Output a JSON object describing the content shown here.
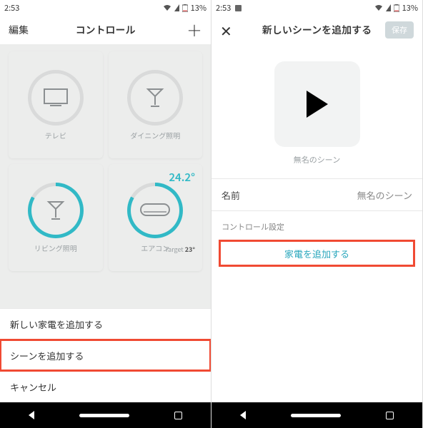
{
  "statusbar": {
    "time": "2:53",
    "battery_text": "13%"
  },
  "left": {
    "header": {
      "edit": "編集",
      "title": "コントロール"
    },
    "tiles": {
      "tv": "テレビ",
      "dining_light": "ダイニング照明",
      "living_light": "リビング照明",
      "aircon": "エアコン",
      "aircon_temp": "24.2°",
      "aircon_target_label": "Target",
      "aircon_target_value": "23°"
    },
    "sheet": {
      "add_appliance": "新しい家電を追加する",
      "add_scene": "シーンを追加する",
      "cancel": "キャンセル"
    }
  },
  "right": {
    "header": {
      "title": "新しいシーンを追加する",
      "save": "保存"
    },
    "scene_caption": "無名のシーン",
    "field_name_label": "名前",
    "field_name_value": "無名のシーン",
    "section_label": "コントロール設定",
    "add_appliance_btn": "家電を追加する"
  }
}
